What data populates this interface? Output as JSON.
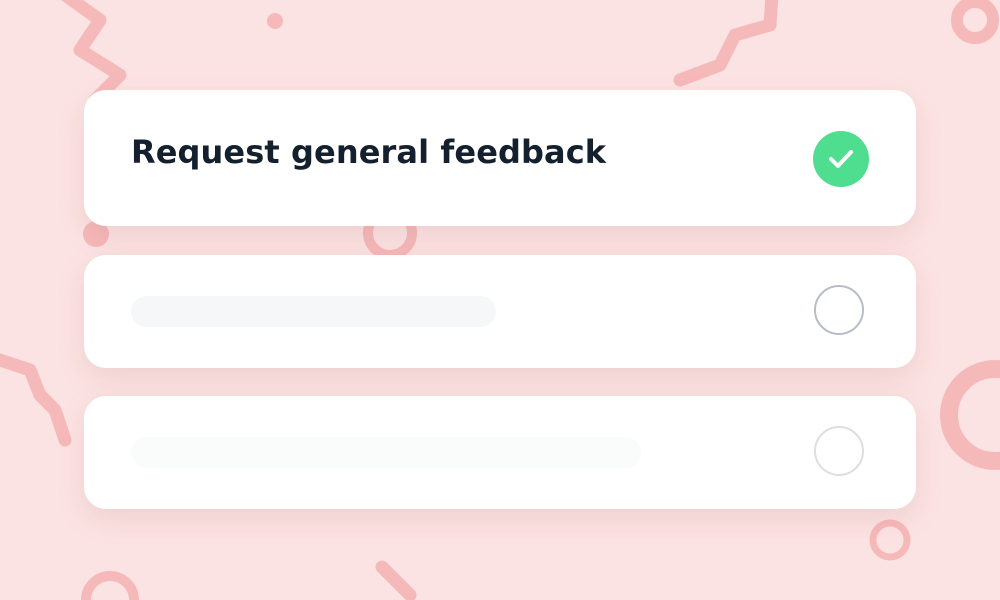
{
  "options": [
    {
      "label": "Request general feedback",
      "selected": true
    },
    {
      "label": "",
      "selected": false
    },
    {
      "label": "",
      "selected": false
    }
  ],
  "colors": {
    "background": "#fce3e3",
    "card": "#ffffff",
    "check": "#4fdd8f",
    "text": "#14202e",
    "decoration": "#f6b8b8"
  },
  "icons": {
    "selected": "check-icon",
    "unselected": "radio-circle-icon"
  }
}
